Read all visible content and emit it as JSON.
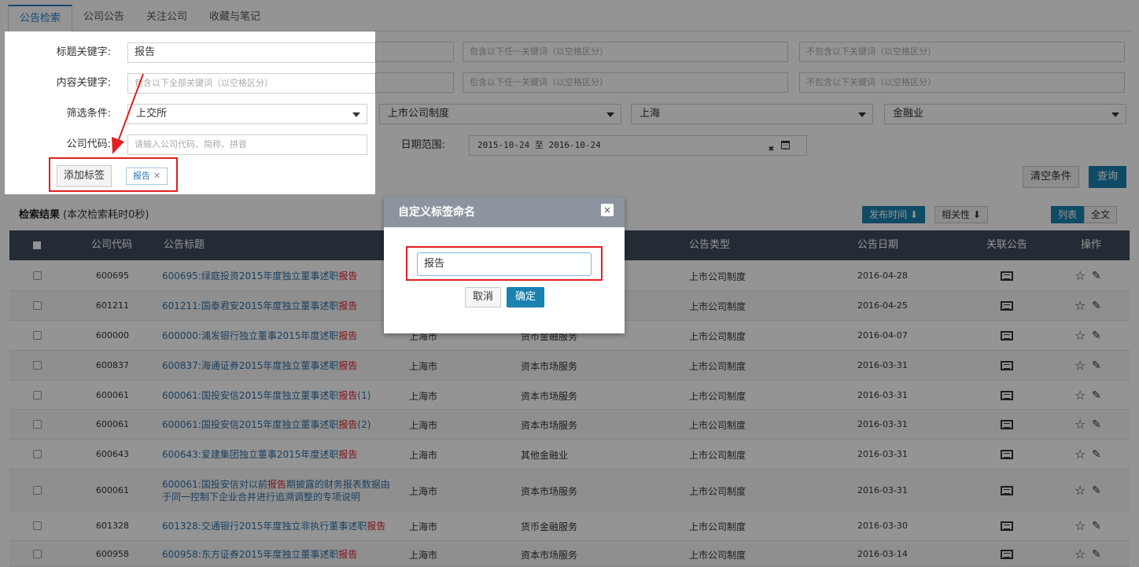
{
  "tabs": [
    "公告检索",
    "公司公告",
    "关注公司",
    "收藏与笔记"
  ],
  "search": {
    "title_label": "标题关键字:",
    "title_value": "报告",
    "title_any_placeholder": "包含以下任一关键词（以空格区分）",
    "title_none_placeholder": "不包含以下关键词（以空格区分）",
    "content_label": "内容关键字:",
    "content_all_placeholder": "包含以下全部关键词（以空格区分）",
    "content_any_placeholder": "包含以下任一关键词（以空格区分）",
    "content_none_placeholder": "不包含以下关键词（以空格区分）",
    "filter_label": "筛选条件:",
    "filter_exchange": "上交所",
    "filter_type": "上市公司制度",
    "filter_region": "上海",
    "filter_industry": "金融业",
    "code_label": "公司代码:",
    "code_placeholder": "请输入公司代码、简称、拼音",
    "date_label": "日期范围:",
    "date_value": "2015-10-24 至 2016-10-24",
    "date_clear": "✖",
    "add_tag_label": "添加标签",
    "tag_chip": "报告",
    "tag_chip_close": "✕",
    "clear_label": "清空条件",
    "query_label": "查询"
  },
  "results": {
    "title": "检索结果",
    "subtitle": "(本次检索耗时0秒)",
    "sort_time": "发布时间",
    "sort_time_arrow": "⬇",
    "sort_rel": "相关性",
    "sort_rel_arrow": "⬇",
    "view_list": "列表",
    "view_full": "全文"
  },
  "table": {
    "headers": {
      "code": "公司代码",
      "title": "公告标题",
      "type": "公告类型",
      "date": "公告日期",
      "related": "关联公告",
      "ops": "操作"
    },
    "rows": [
      {
        "code": "600695",
        "title_pre": "600695:绿庭投资2015年度独立董事述职",
        "title_hl": "报告",
        "title_post": "",
        "region": "",
        "industry": "",
        "type": "上市公司制度",
        "date": "2016-04-28"
      },
      {
        "code": "601211",
        "title_pre": "601211:国泰君安2015年度独立董事述职",
        "title_hl": "报告",
        "title_post": "",
        "region": "",
        "industry": "",
        "type": "上市公司制度",
        "date": "2016-04-25"
      },
      {
        "code": "600000",
        "title_pre": "600000:浦发银行独立董事2015年度述职",
        "title_hl": "报告",
        "title_post": "",
        "region": "上海市",
        "industry": "货币金融服务",
        "type": "上市公司制度",
        "date": "2016-04-07"
      },
      {
        "code": "600837",
        "title_pre": "600837:海通证券2015年度独立董事述职",
        "title_hl": "报告",
        "title_post": "",
        "region": "上海市",
        "industry": "资本市场服务",
        "type": "上市公司制度",
        "date": "2016-03-31"
      },
      {
        "code": "600061",
        "title_pre": "600061:国投安信2015年度独立董事述职",
        "title_hl": "报告",
        "title_post": "(1)",
        "region": "上海市",
        "industry": "资本市场服务",
        "type": "上市公司制度",
        "date": "2016-03-31"
      },
      {
        "code": "600061",
        "title_pre": "600061:国投安信2015年度独立董事述职",
        "title_hl": "报告",
        "title_post": "(2)",
        "region": "上海市",
        "industry": "资本市场服务",
        "type": "上市公司制度",
        "date": "2016-03-31"
      },
      {
        "code": "600643",
        "title_pre": "600643:爱建集团独立董事2015年度述职",
        "title_hl": "报告",
        "title_post": "",
        "region": "上海市",
        "industry": "其他金融业",
        "type": "上市公司制度",
        "date": "2016-03-31"
      },
      {
        "code": "600061",
        "title_pre": "600061:国投安信对以前",
        "title_hl": "报告",
        "title_post": "期披露的财务报表数据由于同一控制下企业合并进行追溯调整的专项说明",
        "region": "上海市",
        "industry": "资本市场服务",
        "type": "上市公司制度",
        "date": "2016-03-31"
      },
      {
        "code": "601328",
        "title_pre": "601328:交通银行2015年度独立非执行董事述职",
        "title_hl": "报告",
        "title_post": "",
        "region": "上海市",
        "industry": "货币金融服务",
        "type": "上市公司制度",
        "date": "2016-03-30"
      },
      {
        "code": "600958",
        "title_pre": "600958:东方证券2015年度独立董事述职",
        "title_hl": "报告",
        "title_post": "",
        "region": "上海市",
        "industry": "资本市场服务",
        "type": "上市公司制度",
        "date": "2016-03-14"
      }
    ],
    "related_icon": "list-icon",
    "star_glyph": "☆",
    "edit_glyph": "✎"
  },
  "dialog": {
    "title": "自定义标签命名",
    "close_glyph": "×",
    "input_value": "报告",
    "cancel_label": "取消",
    "ok_label": "确定"
  },
  "colors": {
    "accent": "#1a82b0",
    "highlight": "#d9232b",
    "callout": "#e02020",
    "table_header": "#3d4b5c"
  }
}
